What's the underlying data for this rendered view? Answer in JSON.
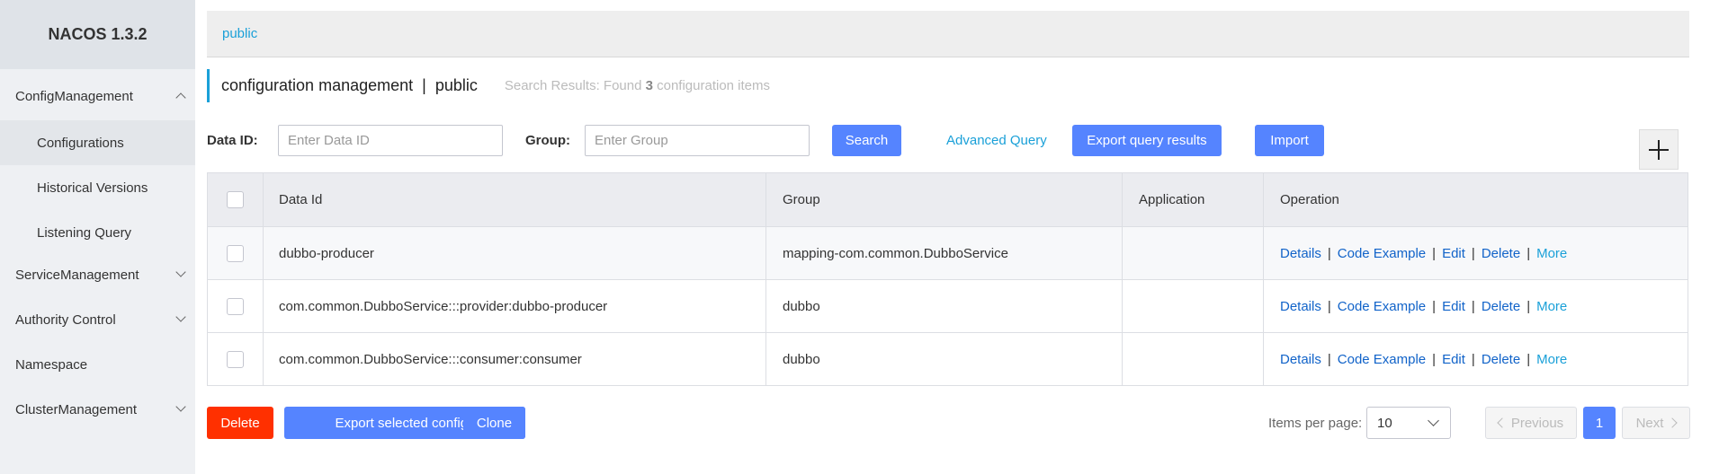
{
  "sidebar": {
    "logo": "NACOS 1.3.2",
    "items": [
      {
        "label": "ConfigManagement",
        "expanded": true
      },
      {
        "label": "Configurations",
        "active": true
      },
      {
        "label": "Historical Versions"
      },
      {
        "label": "Listening Query"
      },
      {
        "label": "ServiceManagement",
        "expanded": false
      },
      {
        "label": "Authority Control",
        "expanded": false
      },
      {
        "label": "Namespace"
      },
      {
        "label": "ClusterManagement",
        "expanded": false
      }
    ]
  },
  "namespace_tab": "public",
  "header": {
    "title": "configuration management",
    "separator": "|",
    "namespace": "public",
    "summary_prefix": "Search Results: Found",
    "summary_count": "3",
    "summary_suffix": "configuration items"
  },
  "filters": {
    "data_id_label": "Data ID:",
    "data_id_placeholder": "Enter Data ID",
    "group_label": "Group:",
    "group_placeholder": "Enter Group",
    "search_button": "Search",
    "advanced_query": "Advanced Query",
    "export_query_button": "Export query results",
    "import_button": "Import"
  },
  "table": {
    "columns": [
      "Data Id",
      "Group",
      "Application",
      "Operation"
    ],
    "rows": [
      {
        "data_id": "dubbo-producer",
        "group": "mapping-com.common.DubboService",
        "application": ""
      },
      {
        "data_id": "com.common.DubboService:::provider:dubbo-producer",
        "group": "dubbo",
        "application": ""
      },
      {
        "data_id": "com.common.DubboService:::consumer:consumer",
        "group": "dubbo",
        "application": ""
      }
    ],
    "operations": {
      "details": "Details",
      "code_example": "Code Example",
      "edit": "Edit",
      "delete": "Delete",
      "more": "More",
      "separator": "|"
    }
  },
  "bottom": {
    "delete_button": "Delete",
    "export_selected_button": "Export selected configs",
    "clone_button": "Clone",
    "items_per_page_label": "Items per page:",
    "items_per_page_value": "10",
    "previous": "Previous",
    "current_page": "1",
    "next": "Next"
  },
  "colors": {
    "primary": "#5584ff",
    "danger": "#ff3000",
    "link": "#1163c9",
    "accent": "#1aa0d8"
  }
}
